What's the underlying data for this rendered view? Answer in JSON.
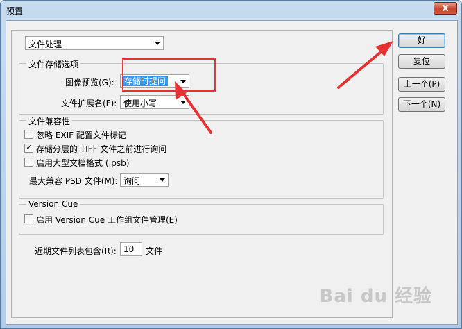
{
  "window": {
    "title": "预置",
    "close_label": "X"
  },
  "category_select": {
    "value": "文件处理"
  },
  "file_saving": {
    "group_title": "文件存储选项",
    "image_preview_label": "图像预览(G):",
    "image_preview_value": "存储时提问",
    "file_ext_label": "文件扩展名(F):",
    "file_ext_value": "使用小写"
  },
  "compat": {
    "group_title": "文件兼容性",
    "ignore_exif": {
      "label": "忽略 EXIF 配置文件标记",
      "checked": false
    },
    "ask_tiff": {
      "label": "存储分层的 TIFF 文件之前进行询问",
      "checked": true
    },
    "large_doc": {
      "label": "启用大型文档格式 (.psb)",
      "checked": false
    },
    "max_psd_label": "最大兼容 PSD 文件(M):",
    "max_psd_value": "询问"
  },
  "version_cue": {
    "group_title": "Version Cue",
    "enable": {
      "label": "启用 Version Cue 工作组文件管理(E)",
      "checked": false
    }
  },
  "recent": {
    "label": "近期文件列表包含(R):",
    "value": "10",
    "suffix": "文件"
  },
  "buttons": {
    "ok": "好",
    "reset": "复位",
    "prev": "上一个(P)",
    "next": "下一个(N)"
  },
  "watermark": "Bai du 经验",
  "colors": {
    "annotation_red": "#e63232",
    "selection_blue": "#3399ff"
  }
}
